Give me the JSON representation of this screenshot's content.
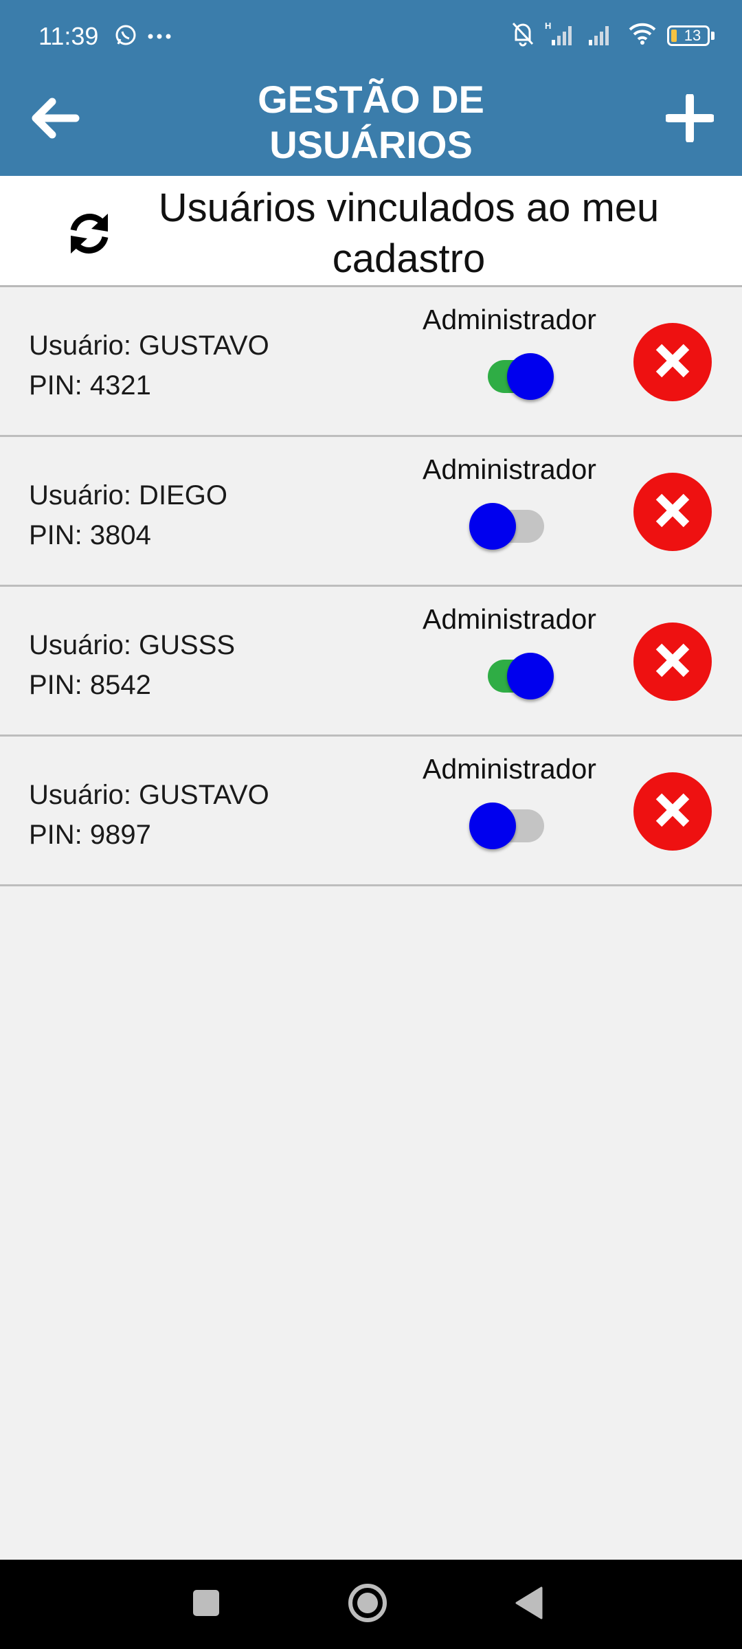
{
  "status_bar": {
    "time": "11:39",
    "battery_level": "13",
    "icons": [
      "whatsapp-icon",
      "more-dots-icon",
      "mute-bell-icon",
      "signal-h-icon",
      "signal-icon",
      "wifi-icon",
      "battery-icon"
    ]
  },
  "header": {
    "title_line1": "GESTÃO DE",
    "title_line2": "USUÁRIOS",
    "back_icon": "arrow-left-icon",
    "add_icon": "plus-icon",
    "background_color": "#3b7dab"
  },
  "subheader": {
    "title_line1": "Usuários vinculados ao meu",
    "title_line2": "cadastro",
    "refresh_icon": "refresh-icon"
  },
  "users": [
    {
      "user_label": "Usuário: GUSTAVO",
      "pin_label": "PIN: 4321",
      "admin_label": "Administrador",
      "admin": true
    },
    {
      "user_label": "Usuário: DIEGO",
      "pin_label": "PIN: 3804",
      "admin_label": "Administrador",
      "admin": false
    },
    {
      "user_label": "Usuário: GUSSS",
      "pin_label": "PIN: 8542",
      "admin_label": "Administrador",
      "admin": true
    },
    {
      "user_label": "Usuário: GUSTAVO",
      "pin_label": "PIN: 9897",
      "admin_label": "Administrador",
      "admin": false
    }
  ],
  "colors": {
    "toggle_on_track": "#2fad45",
    "toggle_off_track": "#c4c4c4",
    "toggle_thumb": "#0000ee",
    "delete_button": "#ee1111"
  },
  "nav_bar": {
    "icons": [
      "recents-square-icon",
      "home-circle-icon",
      "back-triangle-icon"
    ]
  }
}
